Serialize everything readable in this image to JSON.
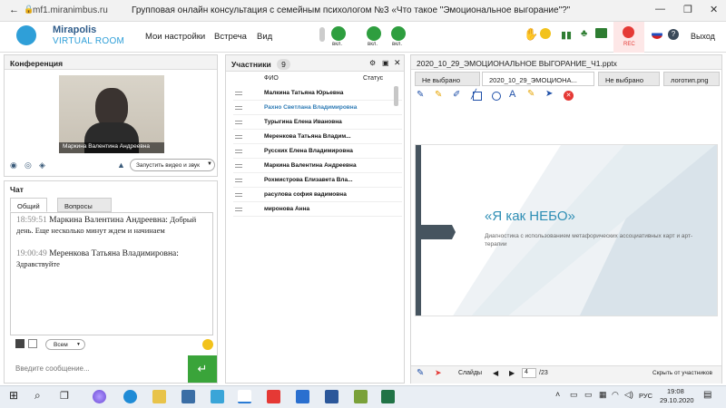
{
  "browser": {
    "url": "mf1.miranimbus.ru",
    "title": "Групповая онлайн консультация с семейным психологом №3 «Что такое \"Эмоциональное выгорание\"?\""
  },
  "app": {
    "logo_line1": "Mirapolis",
    "logo_line2": "VIRTUAL ROOM",
    "menu": [
      "Мои настройки",
      "Встреча",
      "Вид"
    ],
    "media_labels": [
      "вкл.",
      "вкл.",
      "вкл."
    ],
    "rec_label": "REC",
    "exit_label": "Выход"
  },
  "conference": {
    "title": "Конференция",
    "video_caption": "Маркина Валентина  Андреевна",
    "start_av_label": "Запустить видео и звук"
  },
  "chat": {
    "title": "Чат",
    "tabs": [
      "Общий",
      "Вопросы"
    ],
    "messages": [
      {
        "time": "18:59:51",
        "author": "Маркина Валентина  Андреевна:",
        "text": "Добрый день. Еще несколько минут ждем и начинаем"
      },
      {
        "time": "19:00:49",
        "author": "Меренкова  Татьяна Владимировна:",
        "text": "Здравствуйте"
      }
    ],
    "recipient": "Всем",
    "input_placeholder": "Введите сообщение..."
  },
  "participants": {
    "title": "Участники",
    "count": "9",
    "col_name": "ФИО",
    "col_status": "Статус",
    "list": [
      "Малкина Татьяна  Юрьевна",
      "Рахно Светлана  Владимировна",
      "Турыгина  Елена  Ивановна",
      "Меренкова  Татьяна  Владим...",
      "Русских Елена Владимировна",
      "Маркина Валентина  Андреевна",
      "Рохмистрова  Елизавета Вла...",
      "расулова  софия вадимовна",
      "миронова  Анна"
    ]
  },
  "presentation": {
    "file": "2020_10_29_ЭМОЦИОНАЛЬНОЕ ВЫГОРАНИЕ_Ч1.pptx",
    "tabs": [
      "Не выбрано",
      "2020_10_29_ЭМОЦИОНА...",
      "Не выбрано",
      "логотип.png"
    ],
    "slide_title": "«Я как НЕБО»",
    "slide_subtitle": "Диагностика с использованием метафорических ассоциативных карт и арт-терапии",
    "slides_label": "Слайды",
    "page_current": "4",
    "page_total": "/23",
    "hide_label": "Скрыть от участников"
  },
  "taskbar": {
    "lang": "РУС",
    "time": "19:08",
    "date": "29.10.2020"
  },
  "colors": {
    "accent": "#2aa6d6",
    "green": "#2e9e3f",
    "send": "#3aa43a",
    "rec": "#e53935"
  }
}
